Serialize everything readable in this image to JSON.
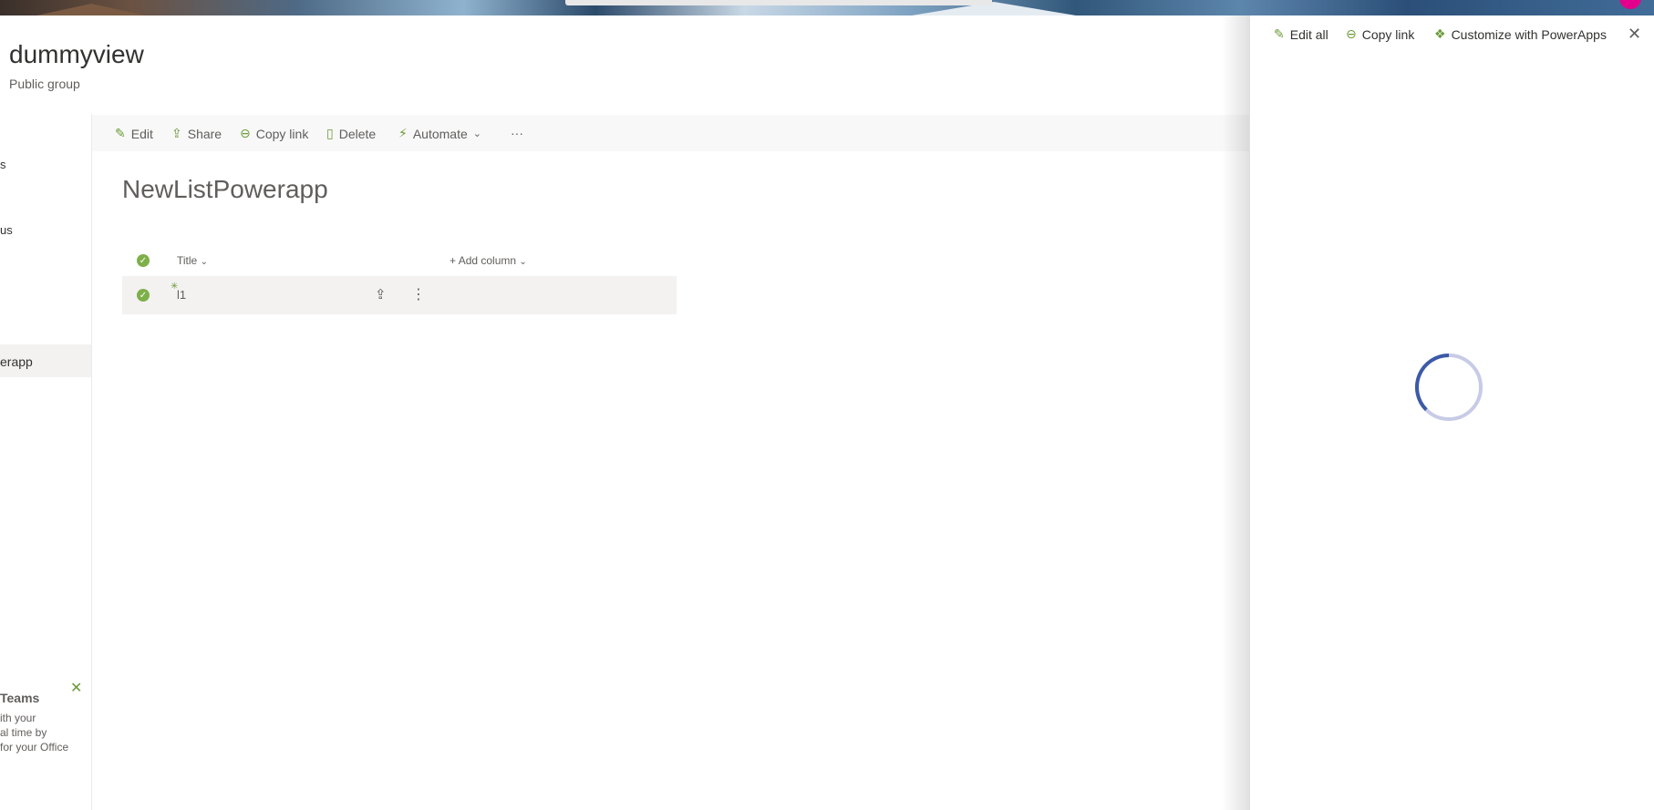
{
  "site": {
    "title": "dummyview",
    "subtitle": "Public group"
  },
  "nav": {
    "fragments": [
      "s",
      "us"
    ],
    "selected_label": "erapp",
    "teams_title": "Teams",
    "teams_lines": [
      "ith your",
      "al time by",
      "for your Office"
    ]
  },
  "commandbar": {
    "edit": "Edit",
    "share": "Share",
    "copy_link": "Copy link",
    "delete": "Delete",
    "automate": "Automate",
    "more": "···"
  },
  "list": {
    "title": "NewListPowerapp",
    "columns": {
      "title": "Title",
      "add_column": "Add column"
    },
    "rows": [
      {
        "title": "l1"
      }
    ]
  },
  "panel": {
    "edit_all": "Edit all",
    "copy_link": "Copy link",
    "customize": "Customize with PowerApps"
  },
  "colors": {
    "accent": "#6b9b37",
    "spinner": "#3b5aa8",
    "spinner_track": "#c7cbe6",
    "avatar": "#e3008c"
  },
  "icons": [
    "pencil-icon",
    "share-icon",
    "link-icon",
    "trash-icon",
    "automate-icon",
    "chevron-down-icon",
    "more-icon",
    "check-circle-icon",
    "plus-icon",
    "close-icon",
    "powerapps-icon",
    "spinner-icon"
  ]
}
